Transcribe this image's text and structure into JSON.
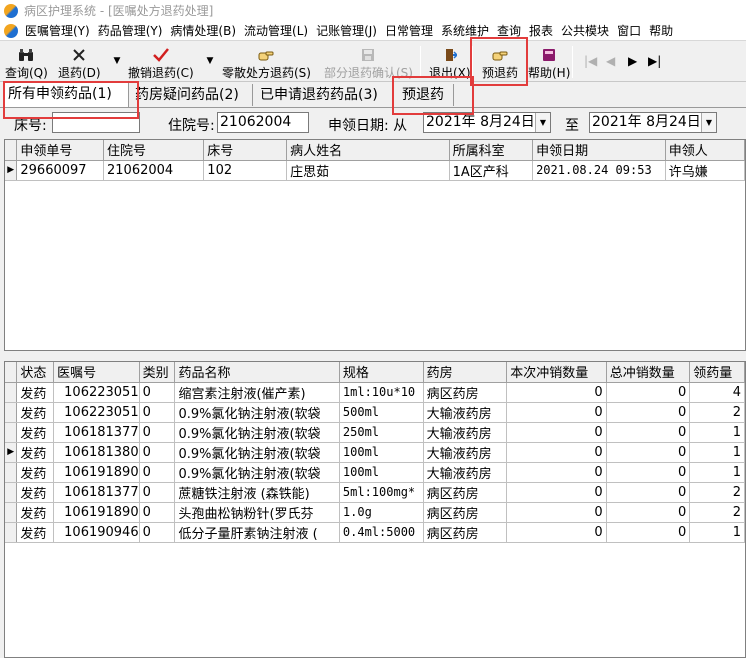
{
  "window": {
    "title": "病区护理系统 - [医嘱处方退药处理]"
  },
  "menu": [
    "医嘱管理(Y)",
    "药品管理(Y)",
    "病情处理(B)",
    "流动管理(L)",
    "记账管理(J)",
    "日常管理",
    "系统维护",
    "查询",
    "报表",
    "公共模块",
    "窗口",
    "帮助"
  ],
  "toolbar": {
    "query": "查询(Q)",
    "return": "退药(D)",
    "cancel_return": "撤销退药(C)",
    "scattered_return": "零散处方退药(S)",
    "partial_confirm": "部分退药确认(S)",
    "exit": "退出(X)",
    "pre_return": "预退药",
    "help": "帮助(H)"
  },
  "tabs": [
    "所有申领药品(1)",
    "药房疑问药品(2)",
    "已申请退药药品(3)",
    "预退药"
  ],
  "filter": {
    "bed_label": "床号:",
    "bed_value": "",
    "admission_label": "住院号:",
    "admission_value": "21062004",
    "date_label": "申领日期: 从",
    "date_from": "2021年  8月24日",
    "to_label": "至",
    "date_to": "2021年  8月24日"
  },
  "upper_grid": {
    "columns": [
      "申领单号",
      "住院号",
      "床号",
      "病人姓名",
      "所属科室",
      "申领日期",
      "申领人"
    ],
    "rows": [
      [
        "29660097",
        "21062004",
        "102",
        "庄思茹",
        "1A区产科",
        "2021.08.24 09:53",
        "许乌嫌"
      ]
    ]
  },
  "lower_grid": {
    "columns": [
      "状态",
      "医嘱号",
      "类别",
      "药品名称",
      "规格",
      "药房",
      "本次冲销数量",
      "总冲销数量",
      "领药量"
    ],
    "rows": [
      [
        "发药",
        "106223051",
        "0",
        "缩宫素注射液(催产素)",
        "1ml:10u*10",
        "病区药房",
        "0",
        "0",
        "4"
      ],
      [
        "发药",
        "106223051",
        "0",
        "0.9%氯化钠注射液(软袋",
        "500ml",
        "大输液药房",
        "0",
        "0",
        "2"
      ],
      [
        "发药",
        "106181377",
        "0",
        "0.9%氯化钠注射液(软袋",
        "250ml",
        "大输液药房",
        "0",
        "0",
        "1"
      ],
      [
        "发药",
        "106181380",
        "0",
        "0.9%氯化钠注射液(软袋",
        "100ml",
        "大输液药房",
        "0",
        "0",
        "1"
      ],
      [
        "发药",
        "106191890",
        "0",
        "0.9%氯化钠注射液(软袋",
        "100ml",
        "大输液药房",
        "0",
        "0",
        "1"
      ],
      [
        "发药",
        "106181377",
        "0",
        "蔗糖铁注射液 (森铁能)",
        "5ml:100mg*",
        "病区药房",
        "0",
        "0",
        "2"
      ],
      [
        "发药",
        "106191890",
        "0",
        "头孢曲松钠粉针(罗氏芬",
        "1.0g",
        "病区药房",
        "0",
        "0",
        "2"
      ],
      [
        "发药",
        "106190946",
        "0",
        "低分子量肝素钠注射液 (",
        "0.4ml:5000",
        "病区药房",
        "0",
        "0",
        "1"
      ]
    ]
  },
  "colors": {
    "highlight_box": "#e23c3c",
    "return_icon": "#d11f1f",
    "help_icon": "#8b1a6b"
  },
  "icons": [
    "binoculars-icon",
    "x-icon",
    "checkmark-icon",
    "hand-pointer-icon",
    "floppy-disk-icon",
    "exit-door-icon",
    "hand-pointer-icon",
    "help-book-icon",
    "nav-first-icon",
    "nav-prev-icon",
    "nav-next-icon",
    "nav-last-icon"
  ]
}
